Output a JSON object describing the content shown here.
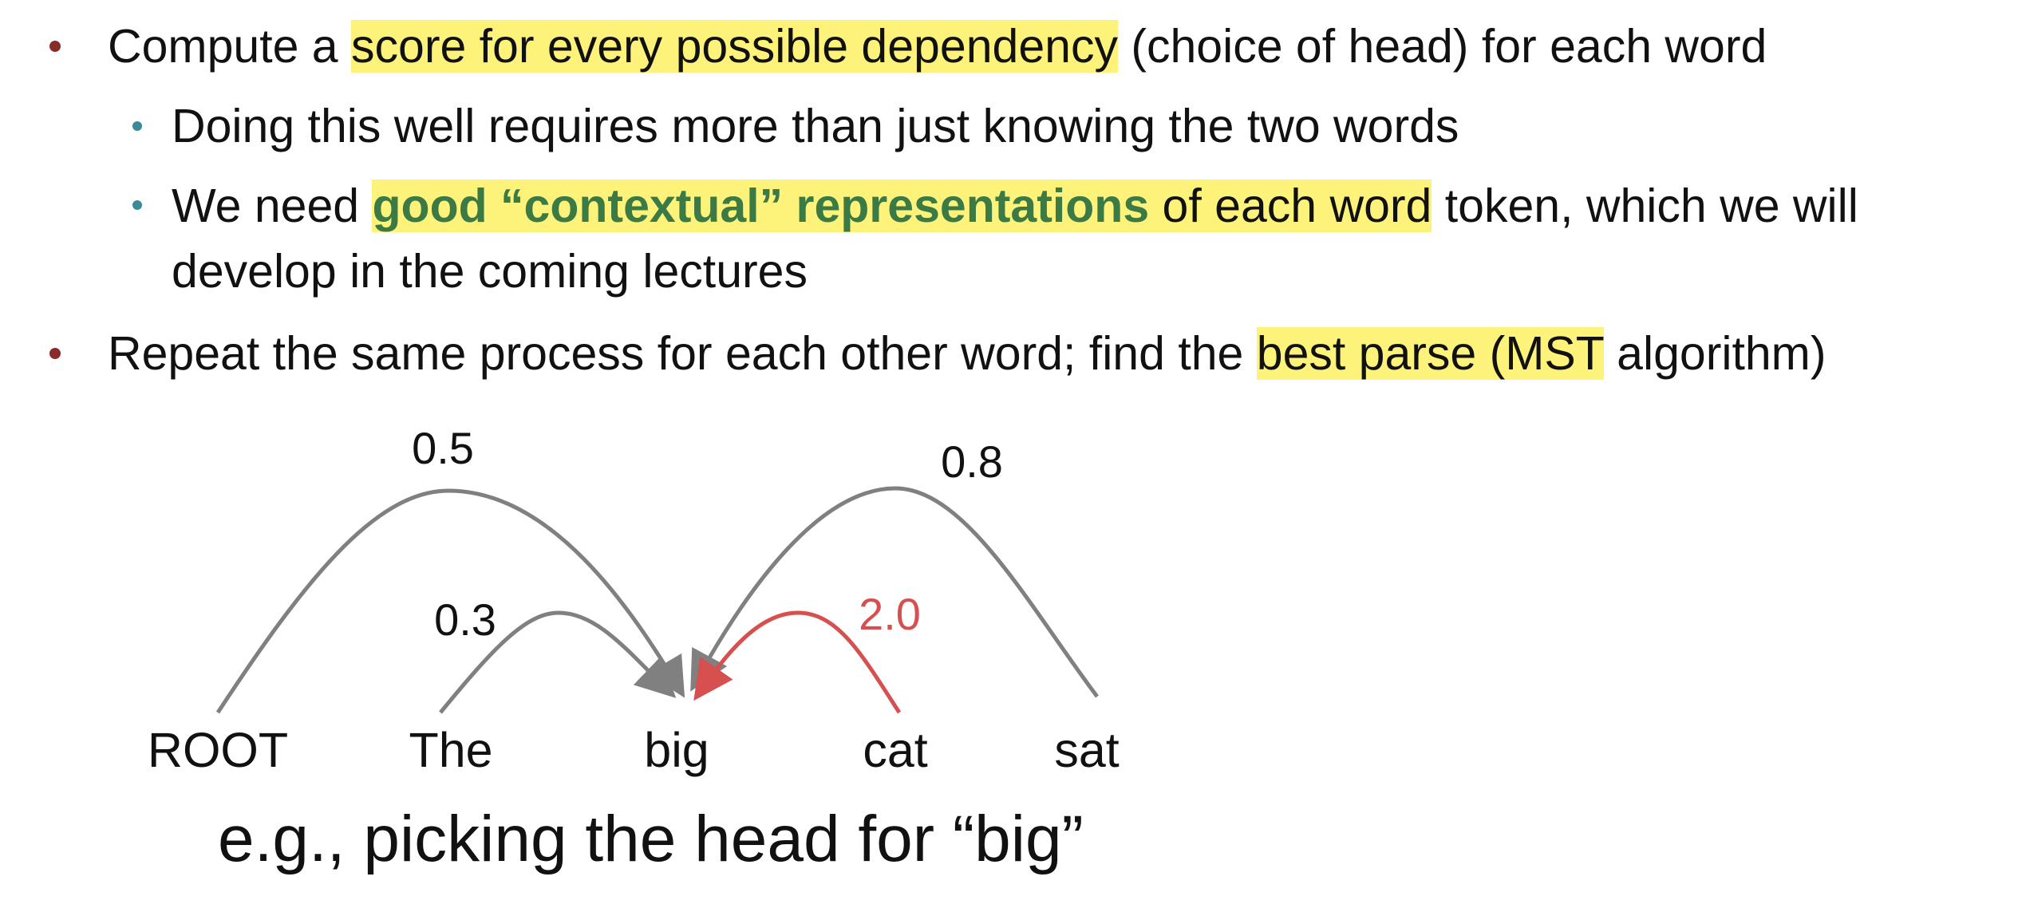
{
  "bullets": {
    "b1": {
      "pre": "Compute a ",
      "highlight": "score for every possible dependency",
      "post": " (choice of head) for each word"
    },
    "b1a": {
      "text": "Doing this well requires more than just knowing the two words"
    },
    "b1b": {
      "pre": "We need ",
      "green_highlight": "good “contextual” representations",
      "highlight": " of each word",
      "post": " token, which we will",
      "cont": "develop in the coming lectures"
    },
    "b2": {
      "pre": "Repeat the same process for each other word; find the ",
      "highlight": "best parse (MST",
      "post": " algorithm)"
    }
  },
  "diagram": {
    "tokens": [
      "ROOT",
      "The",
      "big",
      "cat",
      "sat"
    ],
    "scores": {
      "root_big": "0.5",
      "the_big": "0.3",
      "cat_big": "2.0",
      "sat_big": "0.8"
    },
    "caption": "e.g., picking the head for “big”"
  },
  "colors": {
    "bullet_main": "#8b2a2a",
    "bullet_sub": "#3a8a9a",
    "highlight": "#fdf27a",
    "green_text": "#3b7a45",
    "arc_gray": "#808080",
    "arc_best": "#d65050"
  }
}
